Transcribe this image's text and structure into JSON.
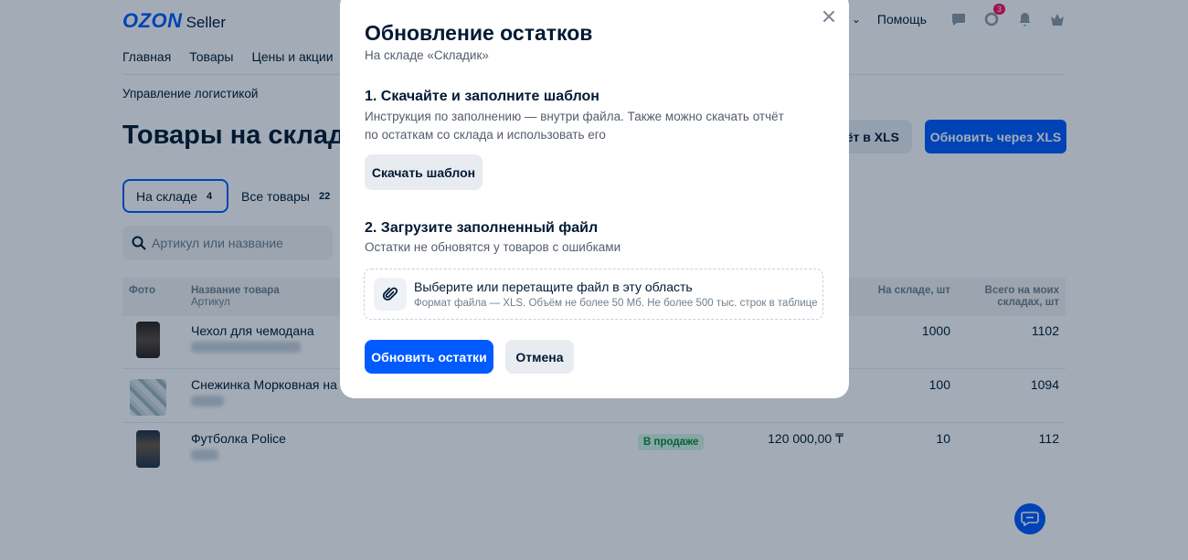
{
  "header": {
    "logo_brand": "OZON",
    "logo_product": "Seller",
    "help_label": "Помощь",
    "notification_count": "3"
  },
  "nav": {
    "items": [
      "Главная",
      "Товары",
      "Цены и акции"
    ]
  },
  "breadcrumb": "Управление логистикой",
  "page_title": "Товары на складе",
  "toolbar": {
    "export_label": "чёт в XLS",
    "update_xls_label": "Обновить через XLS"
  },
  "tabs": [
    {
      "label": "На складе",
      "count": "4"
    },
    {
      "label": "Все товары",
      "count": "22"
    }
  ],
  "search": {
    "placeholder": "Артикул или название"
  },
  "table": {
    "columns": {
      "photo": "Фото",
      "name": "Название товара",
      "sku": "Артикул",
      "in_stock": "На складе, шт",
      "total": "Всего на моих складах, шт"
    },
    "rows": [
      {
        "name": "Чехол для чемодана",
        "in_stock": "1000",
        "total": "1102"
      },
      {
        "name": "Снежинка Морковная на Н",
        "in_stock": "100",
        "total": "1094"
      },
      {
        "name": "Футболка Police",
        "status": "В продаже",
        "price": "120 000,00 ₸",
        "in_stock": "10",
        "total": "112"
      }
    ]
  },
  "modal": {
    "title": "Обновление остатков",
    "subtitle": "На складе «Складик»",
    "step1_title": "1. Скачайте и заполните шаблон",
    "step1_desc": "Инструкция по заполнению — внутри файла. Также можно скачать отчёт по остаткам со склада и использовать его",
    "download_label": "Скачать шаблон",
    "step2_title": "2. Загрузите заполненный файл",
    "step2_desc": "Остатки не обновятся у товаров с ошибками",
    "dropzone_title": "Выберите или перетащите файл в эту область",
    "dropzone_hint": "Формат файла — XLS. Объём не более 50 Мб. Не более 500 тыс. строк в таблице",
    "submit_label": "Обновить остатки",
    "cancel_label": "Отмена"
  },
  "colors": {
    "accent": "#005bff",
    "overlay": "rgba(0,26,52,0.36)",
    "badge": "#f91155"
  }
}
